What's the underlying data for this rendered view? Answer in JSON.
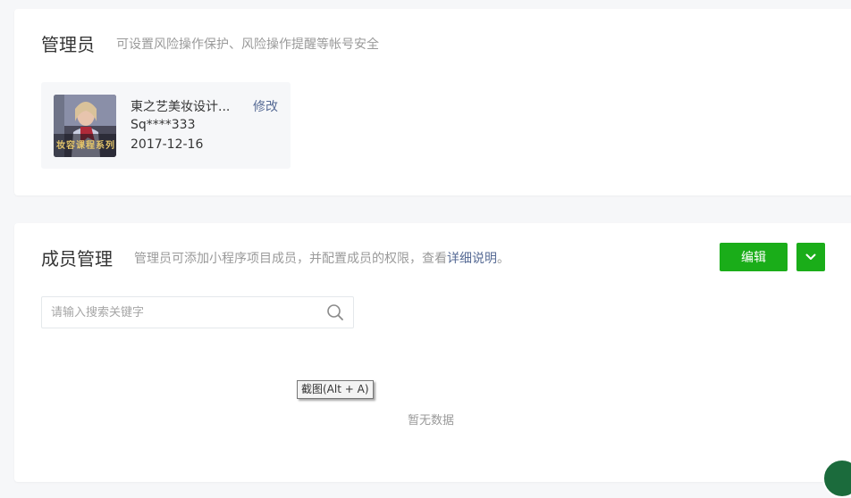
{
  "admin": {
    "title": "管理员",
    "description": "可设置风险操作保护、风险操作提醒等帐号安全",
    "name": "東之艺美妆设计...",
    "modify_label": "修改",
    "account": "Sq****333",
    "date": "2017-12-16",
    "avatar_caption": "妆容课程系列"
  },
  "members": {
    "title": "成员管理",
    "description_prefix": "管理员可添加小程序项目成员，并配置成员的权限，查看",
    "description_link": "详细说明",
    "description_suffix": "。",
    "edit_label": "编辑",
    "search": {
      "placeholder": "请输入搜索关键字",
      "value": ""
    },
    "empty_text": "暂无数据"
  },
  "tooltip": {
    "text": "截图(Alt + A)"
  },
  "colors": {
    "accent_green": "#1aad19",
    "link_blue": "#576b95",
    "background": "#f6f7f9",
    "muted_text": "#9a9a9a"
  },
  "icons": {
    "dropdown": "chevron-down-icon",
    "search": "search-icon"
  }
}
